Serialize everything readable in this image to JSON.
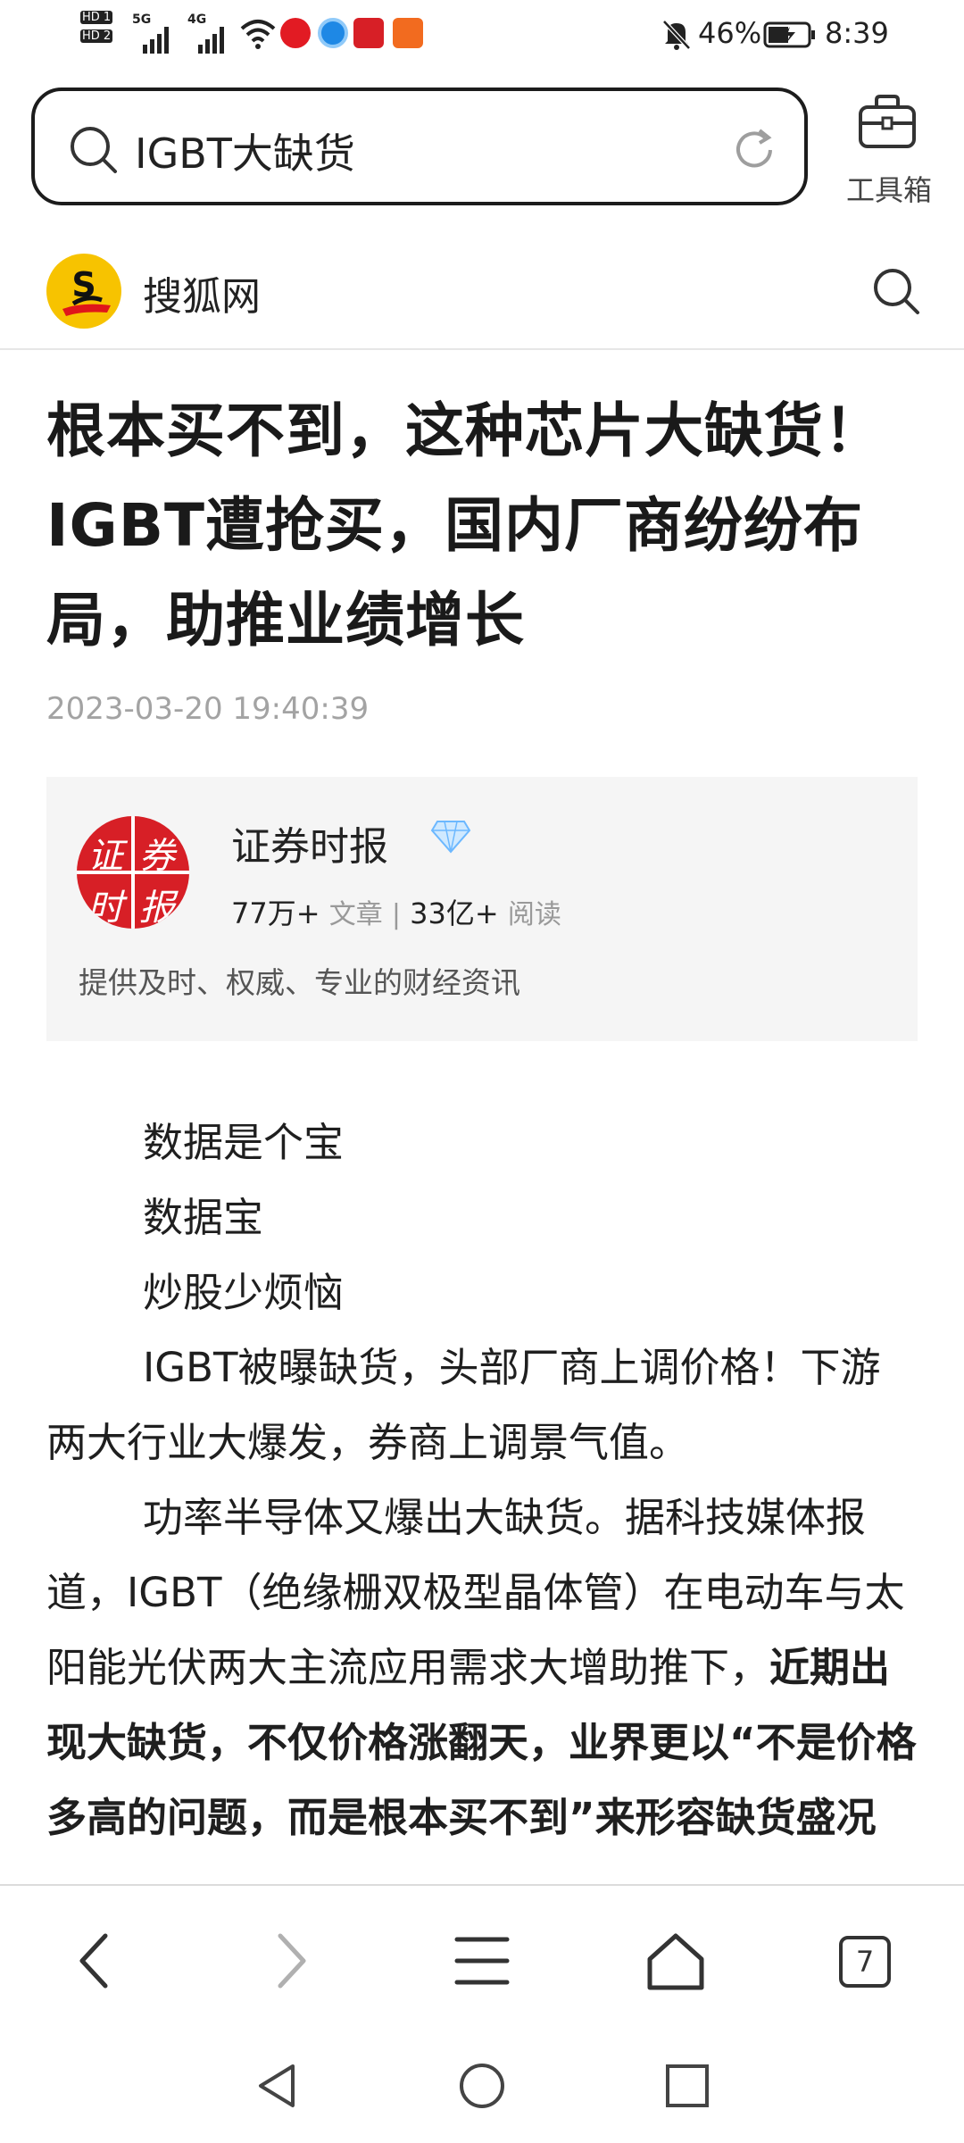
{
  "status_bar": {
    "hd1": "HD 1",
    "hd2": "HD 2",
    "net1": "5G",
    "net2": "4G",
    "battery": "46%",
    "time": "8:39"
  },
  "browser": {
    "search_query": "IGBT大缺货",
    "toolbox_label": "工具箱"
  },
  "site": {
    "name": "搜狐网",
    "logo_letter": "S"
  },
  "article": {
    "headline": "根本买不到，这种芯片大缺货！IGBT遭抢买，国内厂商纷纷布局，助推业绩增长",
    "published": "2023-03-20 19:40:39",
    "author": {
      "name": "证券时报",
      "articles": "77万+",
      "articles_label": "文章",
      "reads": "33亿+",
      "reads_label": "阅读",
      "description": "提供及时、权威、专业的财经资讯",
      "avatar_chars": [
        "证",
        "券",
        "时",
        "报"
      ]
    },
    "paragraphs": [
      "数据是个宝",
      "数据宝",
      "炒股少烦恼",
      "IGBT被曝缺货，头部厂商上调价格！下游两大行业大爆发，券商上调景气值。",
      "功率半导体又爆出大缺货。据科技媒体报道，IGBT（绝缘栅双极型晶体管）在电动车与太阳能光伏两大主流应用需求大增助推下，"
    ],
    "bold_tail": "近期出现大缺货，不仅价格涨翻天，业界更以“不是价格多高的问题，而是根本买不到”来形容缺货盛况"
  },
  "bottom_nav": {
    "tab_count": "7"
  },
  "colors": {
    "sohu_yellow": "#f7c300",
    "sohu_red": "#e0161a",
    "author_red": "#d71f26"
  }
}
